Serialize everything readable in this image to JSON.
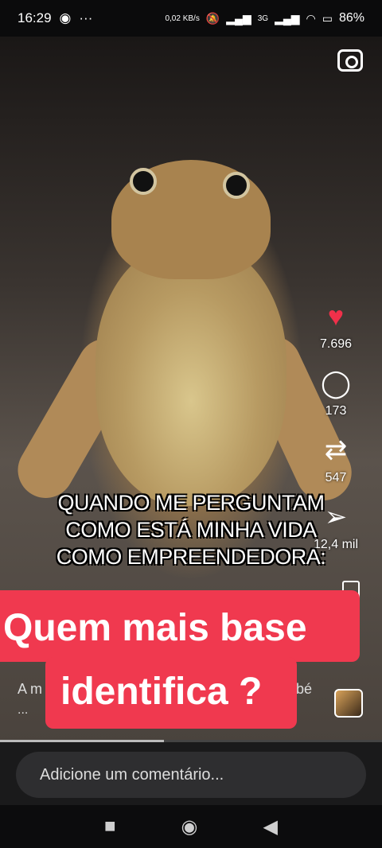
{
  "status_bar": {
    "time": "16:29",
    "left_icons": [
      "whatsapp-icon",
      "more-dots-icon"
    ],
    "data_speed": "0,02 KB/s",
    "network": "3G",
    "battery": "86%"
  },
  "video": {
    "meme_text": "QUANDO ME PERGUNTAM\nCOMO ESTÁ MINHA VIDA\nCOMO EMPREENDEDORA:",
    "overlay_line1": "Quem mais base",
    "overlay_line2": "identifica ?",
    "caption_start": "A m",
    "caption_end": "bé",
    "caption_more": "...",
    "progress": 0.43
  },
  "side_rail": {
    "likes": "7.696",
    "comments": "173",
    "reposts": "547",
    "shares": "12,4 mil"
  },
  "comment": {
    "placeholder": "Adicione um comentário..."
  },
  "colors": {
    "accent": "#f0394f",
    "heart": "#f0304a"
  }
}
